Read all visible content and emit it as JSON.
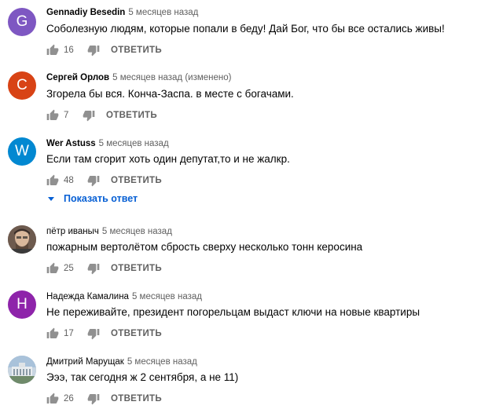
{
  "comments": [
    {
      "author": "Gennadiy Besedin",
      "time": "5 месяцев назад",
      "text": "Соболезную людям, которые попали в беду! Дай Бог, что бы все остались живы!",
      "likes": "16",
      "reply_label": "ОТВЕТИТЬ",
      "avatar_letter": "G",
      "avatar_color": "#7e57c2"
    },
    {
      "author": "Сергей Орлов",
      "time": "5 месяцев назад (изменено)",
      "text": "Згорела бы вся. Конча-Заспа. в месте с богачами.",
      "likes": "7",
      "reply_label": "ОТВЕТИТЬ",
      "avatar_letter": "С",
      "avatar_color": "#d84315"
    },
    {
      "author": "Wer Astuss",
      "time": "5 месяцев назад",
      "text": "Если там сгорит хоть один депутат,то и не жалкр.",
      "likes": "48",
      "reply_label": "ОТВЕТИТЬ",
      "avatar_letter": "W",
      "avatar_color": "#0288d1",
      "show_replies": "Показать ответ"
    },
    {
      "author": "пётр иваныч",
      "time": "5 месяцев назад",
      "text": "пожарным вертолётом сбрость сверху несколько тонн керосина",
      "likes": "25",
      "reply_label": "ОТВЕТИТЬ",
      "avatar_color": "#8d6e63"
    },
    {
      "author": "Надежда Камалина",
      "time": "5 месяцев назад",
      "text": "Не переживайте, президент погорельцам выдаст ключи на новые квартиры",
      "likes": "17",
      "reply_label": "ОТВЕТИТЬ",
      "avatar_letter": "H",
      "avatar_color": "#8e24aa"
    },
    {
      "author": "Дмитрий Марущак",
      "time": "5 месяцев назад",
      "text": "Эээ, так сегодня ж 2 сентября, а не 11)",
      "likes": "26",
      "reply_label": "ОТВЕТИТЬ",
      "avatar_color": "#90a4ae"
    }
  ],
  "colors": {
    "link": "#065fd4",
    "meta": "#606060",
    "text": "#030303"
  },
  "icons": {
    "like": "thumbs-up-icon",
    "dislike": "thumbs-down-icon",
    "expand": "caret-down-icon"
  }
}
